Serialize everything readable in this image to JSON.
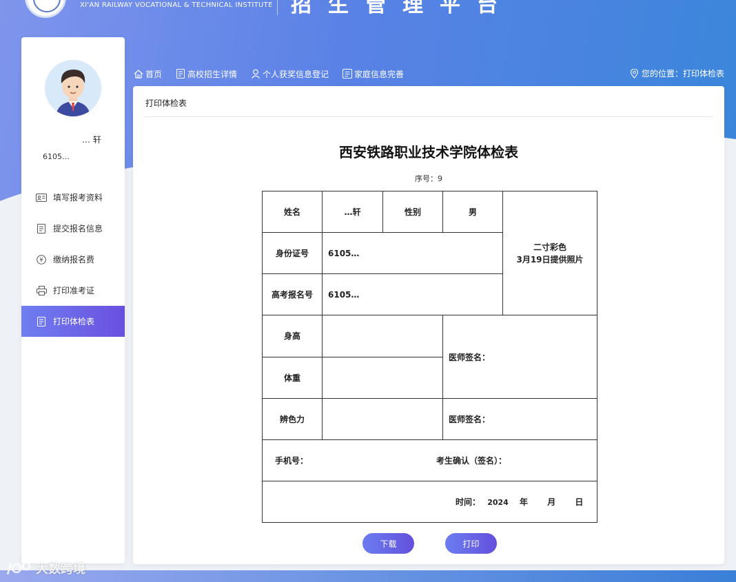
{
  "header": {
    "institute_en": "XI'AN RAILWAY VOCATIONAL & TECHNICAL INSTITUTE",
    "platform_title": "招生管理平台"
  },
  "sidebar": {
    "user_name": "… 轩",
    "user_id": "6105…",
    "items": [
      {
        "label": "填写报考资料",
        "icon": "id-card-icon"
      },
      {
        "label": "提交报名信息",
        "icon": "document-icon"
      },
      {
        "label": "缴纳报名费",
        "icon": "yen-circle-icon"
      },
      {
        "label": "打印准考证",
        "icon": "printer-icon"
      },
      {
        "label": "打印体检表",
        "icon": "document-icon"
      }
    ],
    "active_index": 4
  },
  "nav": {
    "items": [
      {
        "label": "首页",
        "icon": "home-icon"
      },
      {
        "label": "高校招生详情",
        "icon": "document-icon"
      },
      {
        "label": "个人获奖信息登记",
        "icon": "user-icon"
      },
      {
        "label": "家庭信息完善",
        "icon": "list-icon"
      }
    ],
    "location_label": "您的位置：打印体检表"
  },
  "panel": {
    "title": "打印体检表"
  },
  "form": {
    "title": "西安铁路职业技术学院体检表",
    "serial": "序号：9",
    "name_label": "姓名",
    "name_value": "…轩",
    "gender_label": "性别",
    "gender_value": "男",
    "id_label": "身份证号",
    "id_value": "6105…",
    "exam_no_label": "高考报名号",
    "exam_no_value": "6105…",
    "photo_line1": "二寸彩色",
    "photo_line2": "3月19日提供照片",
    "height_label": "身高",
    "weight_label": "体重",
    "color_label": "辨色力",
    "doctor_sign_label": "医师签名：",
    "phone_label": "手机号：",
    "confirm_label": "考生确认（签名）：",
    "time_label": "时间：",
    "year_value": "2024",
    "year_unit": "年",
    "month_unit": "月",
    "day_unit": "日"
  },
  "buttons": {
    "download": "下载",
    "print": "打印"
  },
  "watermark": {
    "text": "大数跨境"
  },
  "colors": {
    "accent": "#6a5ae6",
    "header_blue": "#5a82e6"
  }
}
